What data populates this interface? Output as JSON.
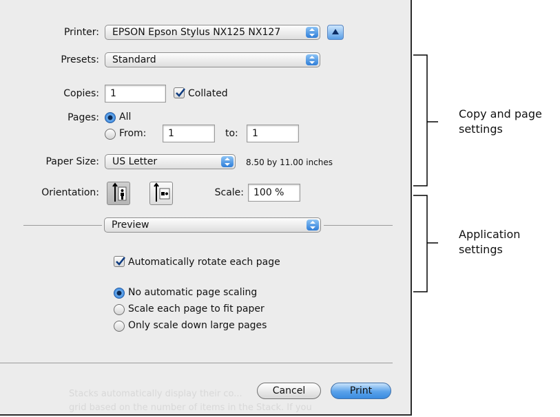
{
  "dialog": {
    "printer": {
      "label": "Printer:",
      "value": "EPSON Epson Stylus NX125 NX127"
    },
    "presets": {
      "label": "Presets:",
      "value": "Standard"
    },
    "copies": {
      "label": "Copies:",
      "value": "1",
      "collated_label": "Collated",
      "collated_checked": true
    },
    "pages": {
      "label": "Pages:",
      "all_label": "All",
      "from_label": "From:",
      "from_value": "1",
      "to_label": "to:",
      "to_value": "1",
      "selected": "All"
    },
    "paper_size": {
      "label": "Paper Size:",
      "value": "US Letter",
      "dimensions": "8.50 by 11.00 inches"
    },
    "orientation": {
      "label": "Orientation:",
      "selected": "portrait"
    },
    "scale": {
      "label": "Scale:",
      "value": "100 %"
    },
    "pane_select": {
      "value": "Preview"
    },
    "preview": {
      "auto_rotate_label": "Automatically rotate each page",
      "auto_rotate_checked": true,
      "scaling_options": [
        "No automatic page scaling",
        "Scale each page to fit paper",
        "Only scale down large pages"
      ],
      "scaling_selected": 0
    },
    "buttons": {
      "cancel": "Cancel",
      "print": "Print"
    },
    "background_text": [
      "Stacks automatically display their co...",
      "grid based on the number of items in the Stack. If you"
    ]
  },
  "callouts": {
    "copy_page": [
      "Copy and page",
      "settings"
    ],
    "application": [
      "Application",
      "settings"
    ]
  },
  "colors": {
    "accent": "#2f7ed8",
    "dialog_bg": "#ececec"
  }
}
